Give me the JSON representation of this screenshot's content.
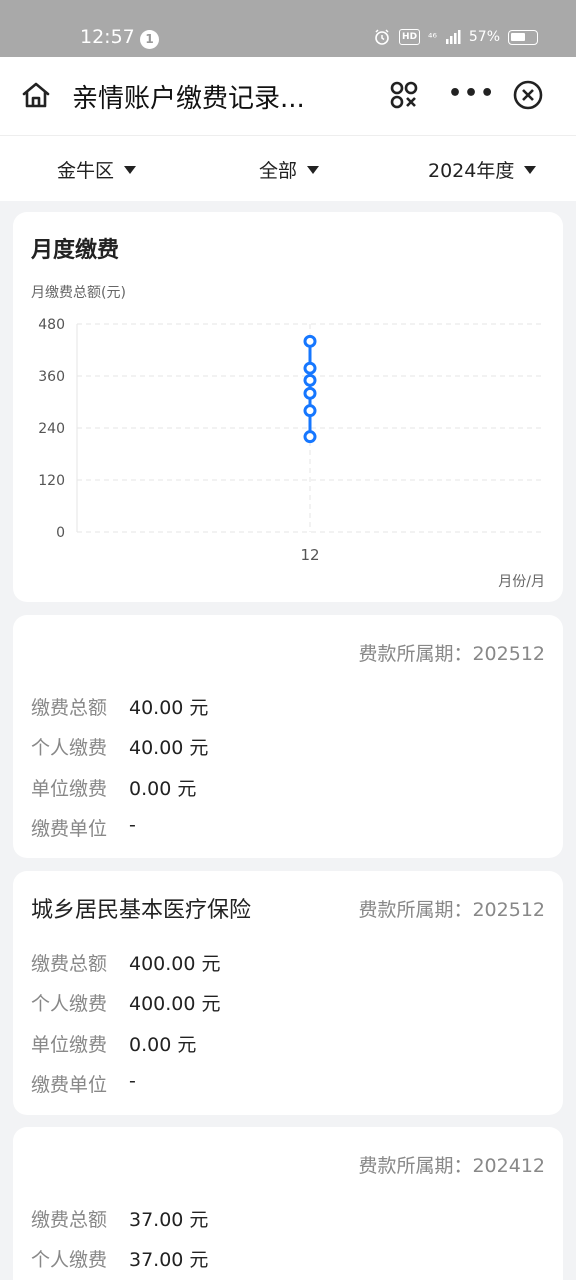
{
  "status": {
    "time": "12:57",
    "notif_count": "1",
    "hd": "HD",
    "net": "⁴⁶",
    "battery": "57%"
  },
  "nav": {
    "title": "亲情账户缴费记录...",
    "more": "•••"
  },
  "filters": [
    {
      "label": "金牛区"
    },
    {
      "label": "全部"
    },
    {
      "label": "2024年度"
    }
  ],
  "chart_card": {
    "title": "月度缴费"
  },
  "chart_data": {
    "type": "scatter",
    "title": "月度缴费",
    "ylabel": "月缴费总额(元)",
    "xlabel": "月份/月",
    "x_ticks": [
      "12"
    ],
    "y_ticks": [
      0,
      120,
      240,
      360,
      480
    ],
    "ylim": [
      0,
      480
    ],
    "grid": true,
    "series": [
      {
        "x": [
          "12",
          "12",
          "12",
          "12",
          "12",
          "12"
        ],
        "values": [
          440,
          378,
          350,
          320,
          280,
          220
        ]
      }
    ],
    "colors": {
      "series": "#1677ff",
      "grid": "#e6e6e6"
    }
  },
  "records": [
    {
      "title": "",
      "period_label": "费款所属期：",
      "period": "202512",
      "rows": [
        {
          "k": "缴费总额",
          "v": "40.00 元"
        },
        {
          "k": "个人缴费",
          "v": "40.00 元"
        },
        {
          "k": "单位缴费",
          "v": "0.00 元"
        },
        {
          "k": "缴费单位",
          "v": "-"
        }
      ]
    },
    {
      "title": "城乡居民基本医疗保险",
      "period_label": "费款所属期：",
      "period": "202512",
      "rows": [
        {
          "k": "缴费总额",
          "v": "400.00 元"
        },
        {
          "k": "个人缴费",
          "v": "400.00 元"
        },
        {
          "k": "单位缴费",
          "v": "0.00 元"
        },
        {
          "k": "缴费单位",
          "v": "-"
        }
      ]
    },
    {
      "title": "",
      "period_label": "费款所属期：",
      "period": "202412",
      "rows": [
        {
          "k": "缴费总额",
          "v": "37.00 元"
        },
        {
          "k": "个人缴费",
          "v": "37.00 元"
        }
      ]
    }
  ]
}
